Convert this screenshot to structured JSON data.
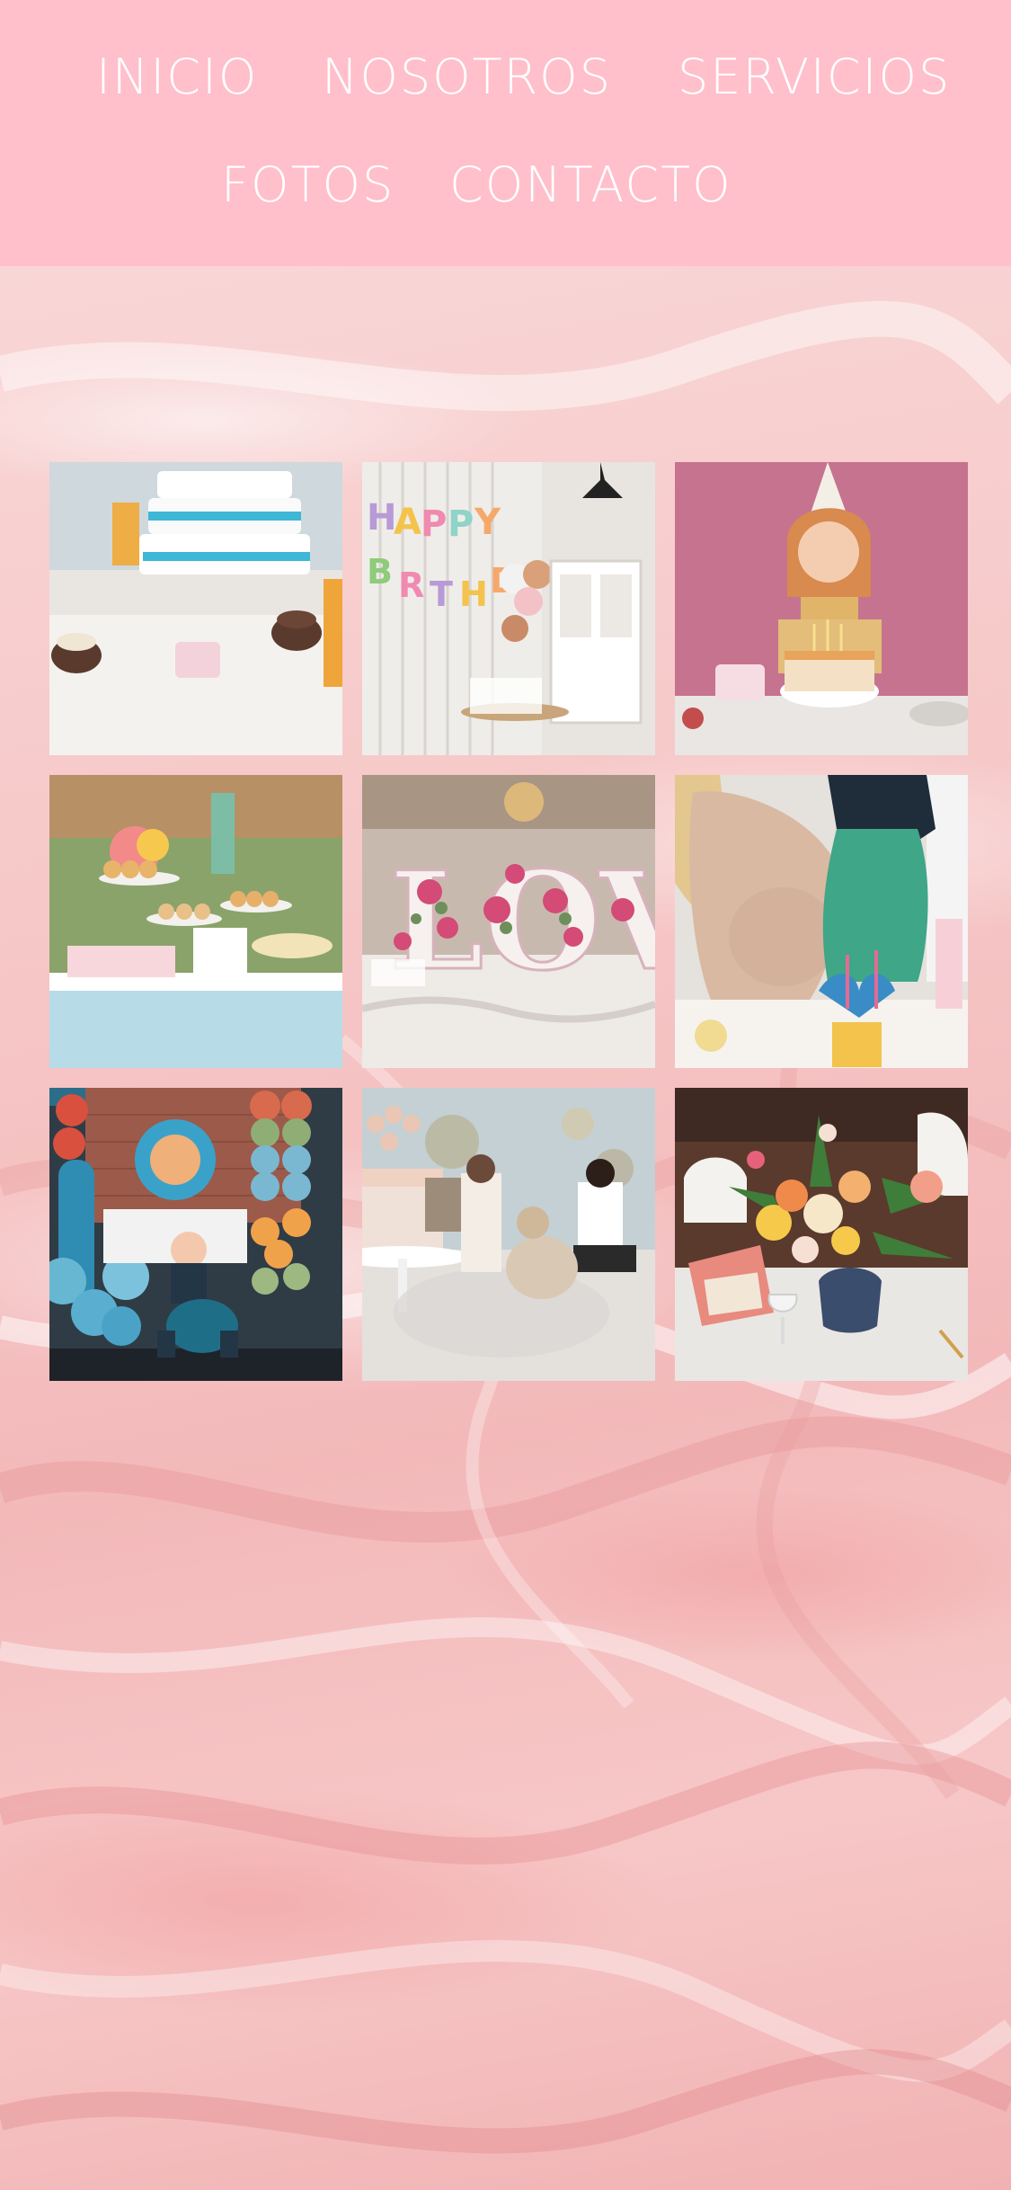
{
  "nav": {
    "items": [
      {
        "label": "INICIO"
      },
      {
        "label": "NOSOTROS"
      },
      {
        "label": "SERVICIOS"
      },
      {
        "label": "FOTOS"
      },
      {
        "label": "CONTACTO"
      }
    ]
  },
  "gallery": {
    "photos": [
      {
        "subject": "diaper-cake-dessert-table"
      },
      {
        "subject": "happy-birthday-balloon-room"
      },
      {
        "subject": "girl-with-birthday-cake"
      },
      {
        "subject": "garden-dessert-buffet"
      },
      {
        "subject": "love-floral-letters"
      },
      {
        "subject": "pregnant-woman-baby-shower"
      },
      {
        "subject": "baby-first-birthday-balloons"
      },
      {
        "subject": "family-party-with-cake"
      },
      {
        "subject": "floral-table-centerpiece"
      }
    ]
  },
  "colors": {
    "header_bg": "#ffbfcb",
    "nav_text": "#ffffff",
    "marble_base": "#f6c6c6"
  }
}
